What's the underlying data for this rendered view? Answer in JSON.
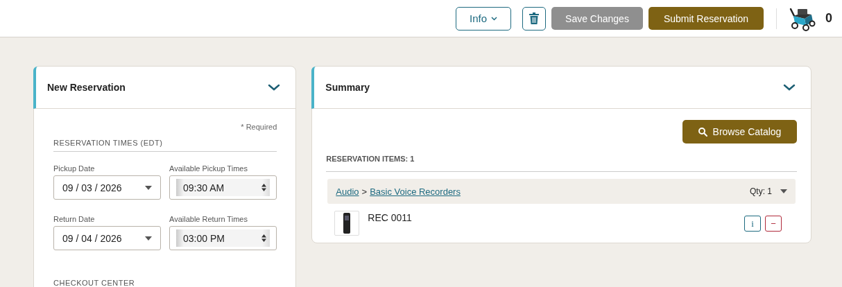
{
  "toolbar": {
    "info_button": "Info",
    "save_button": {
      "label": "Save Changes",
      "disabled": true
    },
    "submit_button": "Submit Reservation",
    "cart_count": "0"
  },
  "new_reservation": {
    "title": "New Reservation",
    "expanded": true,
    "required_note": "* Required",
    "section": "RESERVATION TIMES (EDT)",
    "fields": [
      {
        "label": "Pickup Date",
        "kind": "date",
        "value": "09 / 03 / 2026"
      },
      {
        "label": "Available Pickup Times",
        "kind": "time",
        "value": "09:30 AM"
      },
      {
        "label": "Return Date",
        "kind": "date",
        "value": "09 / 04 / 2026"
      },
      {
        "label": "Available Return Times",
        "kind": "time",
        "value": "03:00 PM"
      }
    ],
    "next_section": "CHECKOUT CENTER"
  },
  "summary": {
    "title": "Summary",
    "expanded": true,
    "browse_button": "Browse Catalog",
    "items_heading": "RESERVATION ITEMS: 1",
    "groups": [
      {
        "category": "Audio",
        "separator": ">",
        "subcategory": "Basic Voice Recorders",
        "qty": "Qty: 1",
        "items": [
          {
            "name": "REC 0011",
            "info_button": "i",
            "remove_button": "−"
          }
        ]
      }
    ]
  }
}
